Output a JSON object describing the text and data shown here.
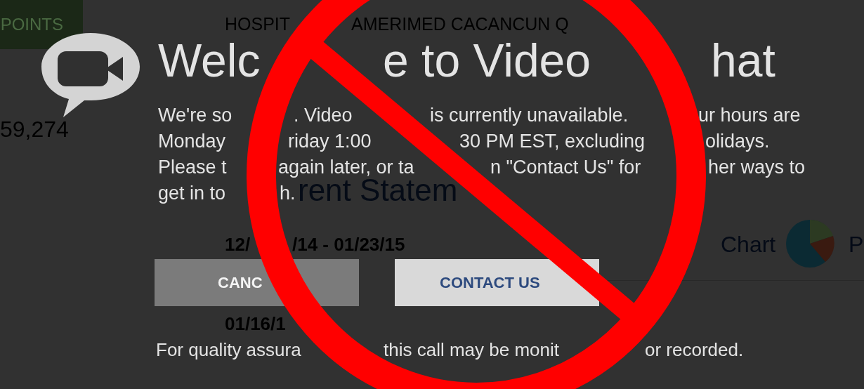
{
  "background": {
    "points_label": "POINTS",
    "points_balance": "59,274",
    "transactions": [
      [
        "HOSPIT",
        "AMERIMED CACANCUN Q"
      ]
    ],
    "statement_title": "rent Statem",
    "statement_period": [
      "12/",
      "/14 - 01/23/15"
    ],
    "chart_label": "Chart",
    "cut_label": "P",
    "date": "01/16/1"
  },
  "dialog": {
    "title": [
      "Welc",
      "e to Video",
      "hat"
    ],
    "message_lines": [
      [
        "We're so",
        ". Video",
        "is currently unavailable.",
        "ur hours are"
      ],
      [
        "Monday",
        "riday 1:00",
        "30 PM EST, excluding",
        "olidays."
      ],
      [
        "Please t",
        "again later, or ta",
        "n \"Contact Us\" for",
        "her ways to"
      ],
      [
        "get in to",
        "h."
      ]
    ],
    "buttons": [
      {
        "label": "CANC",
        "kind": "secondary"
      },
      {
        "label": "CONTACT US",
        "kind": "primary"
      }
    ],
    "footer": [
      "For quality assura",
      "this call may be monit",
      "or recorded."
    ]
  }
}
